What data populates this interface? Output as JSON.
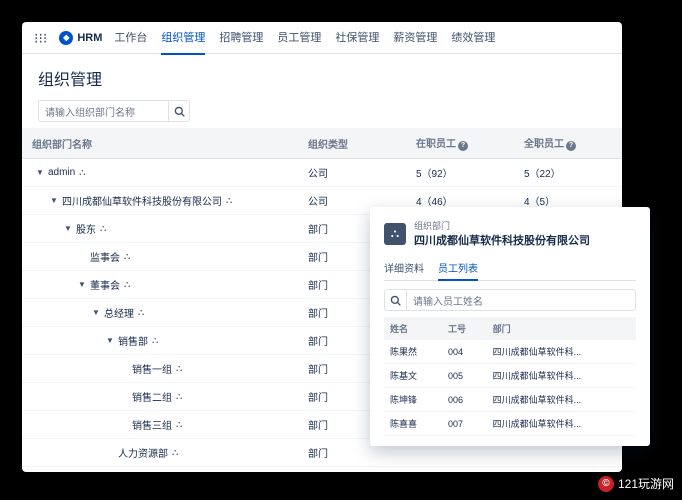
{
  "brand": {
    "name": "HRM"
  },
  "nav": {
    "items": [
      {
        "label": "工作台"
      },
      {
        "label": "组织管理"
      },
      {
        "label": "招聘管理"
      },
      {
        "label": "员工管理"
      },
      {
        "label": "社保管理"
      },
      {
        "label": "薪资管理"
      },
      {
        "label": "绩效管理"
      }
    ],
    "activeIndex": 1
  },
  "page": {
    "title": "组织管理"
  },
  "search": {
    "placeholder": "请输入组织部门名称"
  },
  "table": {
    "headers": {
      "name": "组织部门名称",
      "type": "组织类型",
      "onDuty": "在职员工",
      "fullTime": "全职员工"
    },
    "rows": [
      {
        "depth": 0,
        "chevron": "▼",
        "label": "admin",
        "icon": true,
        "type": "公司",
        "onDuty": "5（92）",
        "fullTime": "5（22）"
      },
      {
        "depth": 1,
        "chevron": "▼",
        "label": "四川成都仙草软件科技股份有限公司",
        "icon": true,
        "type": "公司",
        "onDuty": "4（46）",
        "fullTime": "4（5）"
      },
      {
        "depth": 2,
        "chevron": "▼",
        "label": "股东",
        "icon": true,
        "type": "部门",
        "onDuty": "",
        "fullTime": ""
      },
      {
        "depth": 3,
        "chevron": "",
        "label": "监事会",
        "icon": true,
        "type": "部门",
        "onDuty": "",
        "fullTime": ""
      },
      {
        "depth": 3,
        "chevron": "▼",
        "label": "董事会",
        "icon": true,
        "type": "部门",
        "onDuty": "",
        "fullTime": ""
      },
      {
        "depth": 4,
        "chevron": "▼",
        "label": "总经理",
        "icon": true,
        "type": "部门",
        "onDuty": "",
        "fullTime": ""
      },
      {
        "depth": 5,
        "chevron": "▼",
        "label": "销售部",
        "icon": true,
        "type": "部门",
        "onDuty": "",
        "fullTime": ""
      },
      {
        "depth": 6,
        "chevron": "",
        "label": "销售一组",
        "icon": true,
        "type": "部门",
        "onDuty": "",
        "fullTime": ""
      },
      {
        "depth": 6,
        "chevron": "",
        "label": "销售二组",
        "icon": true,
        "type": "部门",
        "onDuty": "",
        "fullTime": ""
      },
      {
        "depth": 6,
        "chevron": "",
        "label": "销售三组",
        "icon": true,
        "type": "部门",
        "onDuty": "",
        "fullTime": ""
      },
      {
        "depth": 5,
        "chevron": "",
        "label": "人力资源部",
        "icon": true,
        "type": "部门",
        "onDuty": "",
        "fullTime": ""
      }
    ]
  },
  "side": {
    "breadcrumb": "组织部门",
    "title": "四川成都仙草软件科技股份有限公司",
    "tabs": [
      {
        "label": "详细资料"
      },
      {
        "label": "员工列表"
      }
    ],
    "activeTab": 1,
    "searchPlaceholder": "请输入员工姓名",
    "headers": {
      "name": "姓名",
      "code": "工号",
      "dept": "部门"
    },
    "rows": [
      {
        "name": "陈果然",
        "code": "004",
        "dept": "四川成都仙草软件科..."
      },
      {
        "name": "陈基文",
        "code": "005",
        "dept": "四川成都仙草软件科..."
      },
      {
        "name": "陈坤锋",
        "code": "006",
        "dept": "四川成都仙草软件科..."
      },
      {
        "name": "陈喜喜",
        "code": "007",
        "dept": "四川成都仙草软件科..."
      }
    ]
  },
  "watermark": {
    "glyph": "©",
    "text": "121玩游网"
  }
}
